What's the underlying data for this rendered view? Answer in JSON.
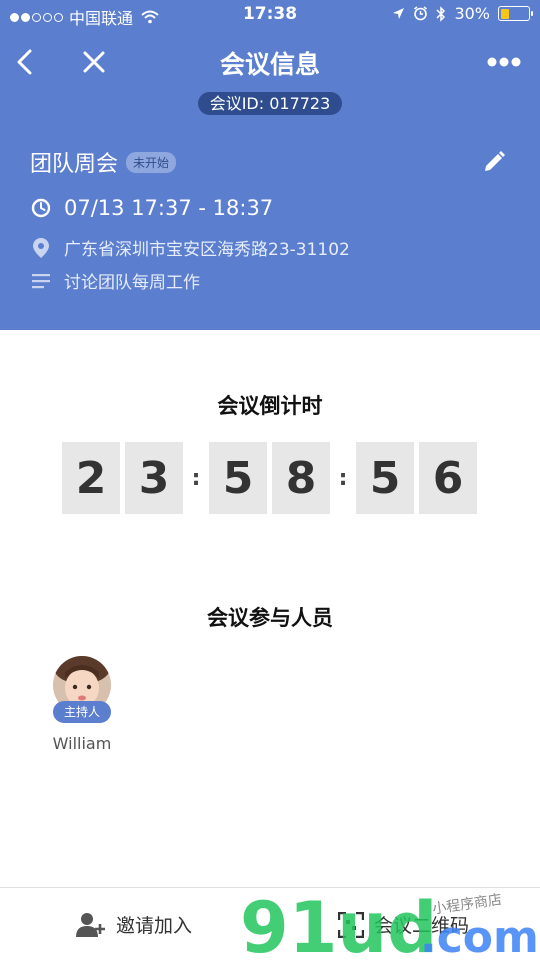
{
  "status_bar": {
    "carrier": "中国联通",
    "time": "17:38",
    "battery": "30%",
    "battery_level": 0.3,
    "signal_dots_filled": 2,
    "signal_dots_total": 5
  },
  "navbar": {
    "title": "会议信息",
    "back_icon": "chevron-left-icon",
    "close_icon": "close-icon",
    "more_icon": "more-dots-icon"
  },
  "meeting": {
    "id_label": "会议ID: 017723",
    "topic": "团队周会",
    "status": "未开始",
    "time": "07/13 17:37 - 18:37",
    "address": "广东省深圳市宝安区海秀路23-31102",
    "description": "讨论团队每周工作"
  },
  "countdown": {
    "title": "会议倒计时",
    "hours": [
      "2",
      "3"
    ],
    "minutes": [
      "5",
      "8"
    ],
    "seconds": [
      "5",
      "6"
    ],
    "separator": ":"
  },
  "participants": {
    "title": "会议参与人员",
    "list": [
      {
        "name": "William",
        "role": "主持人"
      }
    ]
  },
  "bottom_bar": {
    "invite_label": "邀请加入",
    "qrcode_label": "会议二维码"
  },
  "colors": {
    "header_bg": "#5b7fce",
    "id_pill": "#2f4d8e",
    "digit_bg": "#e7e7e7",
    "watermark_green": "#22c55e",
    "watermark_blue": "#3b82f6"
  },
  "watermark": {
    "brand": "91ud.com",
    "subtitle": "小程序商店"
  }
}
